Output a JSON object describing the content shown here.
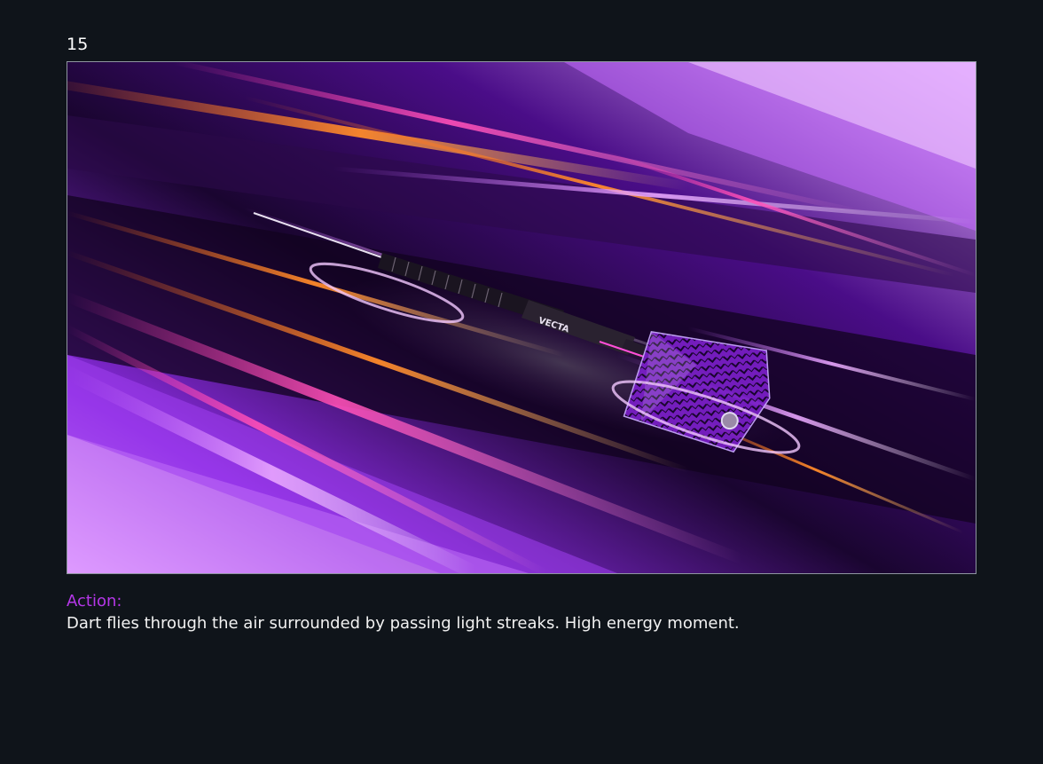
{
  "frame": {
    "number": "15",
    "image_description_alt": "Dart flies through the air surrounded by passing light streaks",
    "dart_brand_text": "VECTA"
  },
  "caption": {
    "label": "Action:",
    "text": "Dart flies through the air surrounded by passing light streaks. High energy moment."
  },
  "colors": {
    "background": "#0f141a",
    "accent": "#b537e8",
    "text": "#f2f2f2"
  }
}
